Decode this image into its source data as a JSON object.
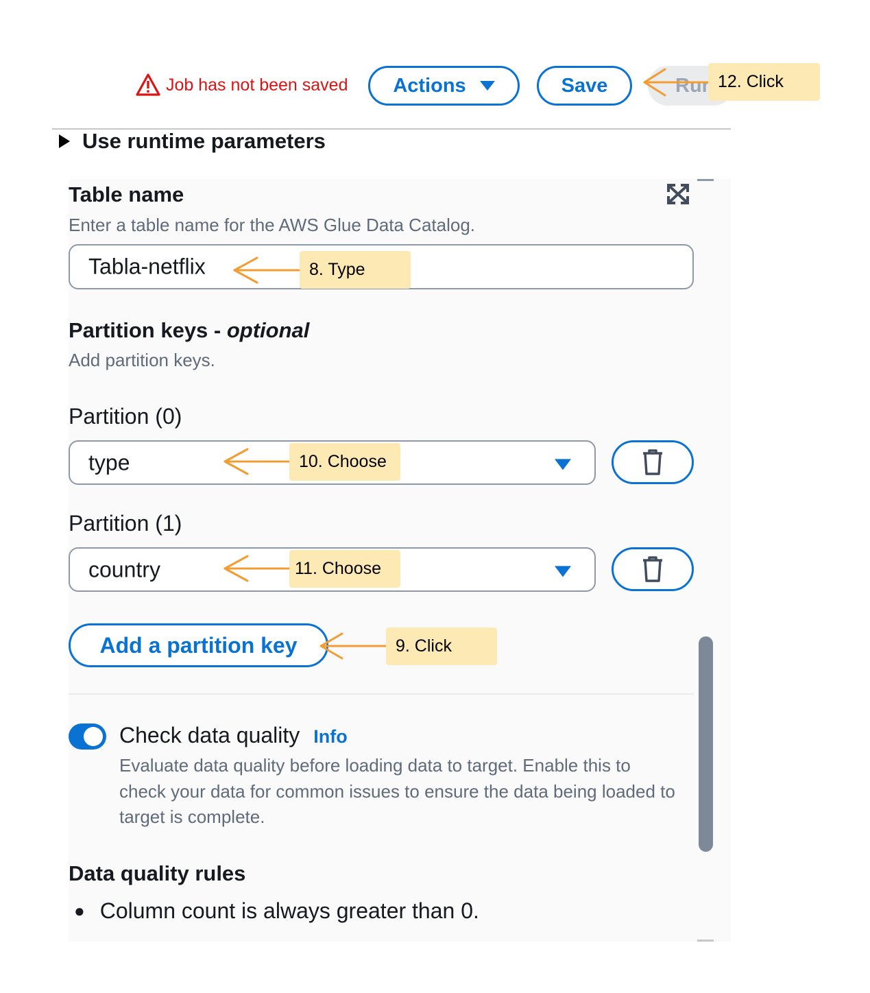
{
  "header": {
    "unsaved_text": "Job has not been saved",
    "actions_label": "Actions",
    "save_label": "Save",
    "run_label": "Run"
  },
  "runtime_params_label": "Use runtime parameters",
  "table_name": {
    "title": "Table name",
    "description": "Enter a table name for the AWS Glue Data Catalog.",
    "value": "Tabla-netflix"
  },
  "partition_keys": {
    "title": "Partition keys - ",
    "title_optional": "optional",
    "description": "Add partition keys.",
    "partitions": [
      {
        "label": "Partition (0)",
        "value": "type"
      },
      {
        "label": "Partition (1)",
        "value": "country"
      }
    ],
    "add_button": "Add a partition key"
  },
  "data_quality": {
    "toggle_on": true,
    "label": "Check data quality",
    "info_link": "Info",
    "description": "Evaluate data quality before loading data to target. Enable this to check your data for common issues to ensure the data being loaded to target is complete."
  },
  "rules": {
    "title": "Data quality rules",
    "items": [
      "Column count is always greater than 0."
    ]
  },
  "annotations": {
    "step8": "8. Type",
    "step9": "9. Click",
    "step10": "10. Choose",
    "step11": "11. Choose",
    "step12": "12. Click",
    "color": "#fde9b4",
    "arrow_color": "#f39c32"
  },
  "colors": {
    "accent": "#0972d3",
    "error": "#d91515",
    "muted_text": "#5f6b7a"
  }
}
